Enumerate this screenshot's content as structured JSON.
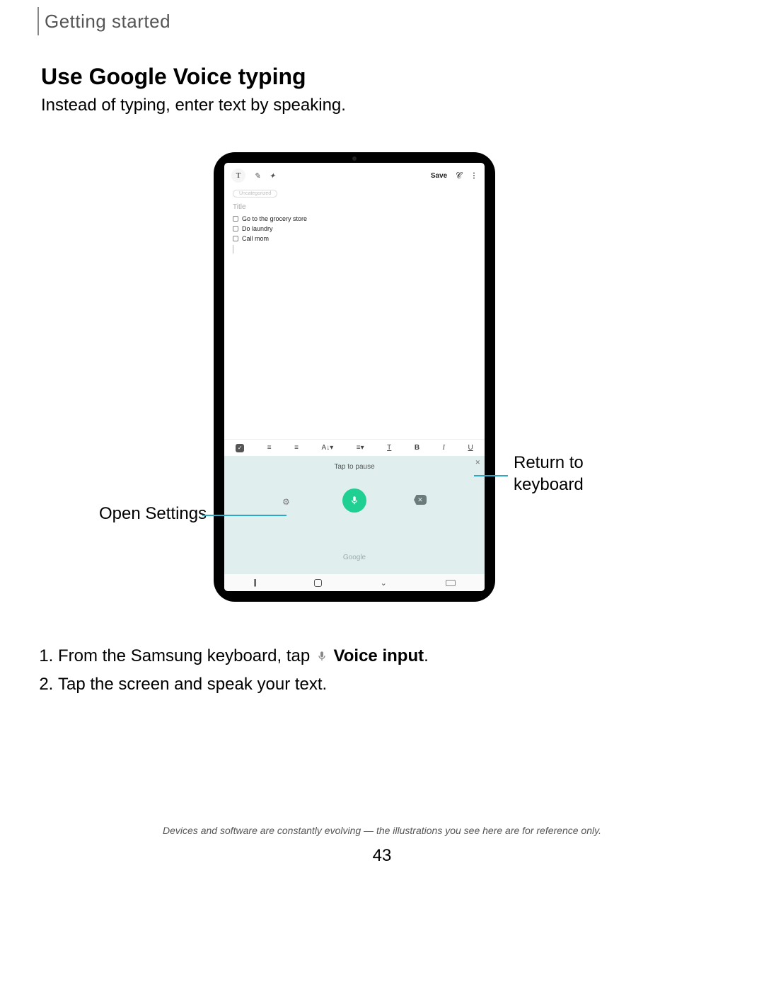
{
  "header": {
    "section": "Getting started"
  },
  "title": "Use Google Voice typing",
  "intro": "Instead of typing, enter text by speaking.",
  "tablet": {
    "topbar": {
      "text_mode": "T",
      "pen_mode": "✎",
      "brush_mode": "✦",
      "save": "Save",
      "attach": "𝒞",
      "more": "⋮"
    },
    "tag": "Uncategorized",
    "title_placeholder": "Title",
    "checklist": [
      "Go to the grocery store",
      "Do laundry",
      "Call mom"
    ],
    "format_bar": {
      "check": "✓",
      "bullets": "≡",
      "numbers": "≡",
      "font": "A↓▾",
      "align": "≡▾",
      "textcolor": "T",
      "bold": "B",
      "italic": "I",
      "underline": "U"
    },
    "voice": {
      "close": "✕",
      "hint": "Tap to pause",
      "settings": "⚙",
      "delete": "✕",
      "brand": "Google"
    },
    "nav": {
      "recents": "|||",
      "back": "⌄"
    }
  },
  "callouts": {
    "open_settings": "Open Settings",
    "return_keyboard_l1": "Return to",
    "return_keyboard_l2": "keyboard"
  },
  "steps": {
    "s1_pre": "From the Samsung keyboard, tap ",
    "s1_bold": "Voice input",
    "s1_post": ".",
    "s2": "Tap the screen and speak your text."
  },
  "footnote": "Devices and software are constantly evolving — the illustrations you see here are for reference only.",
  "page_number": "43"
}
